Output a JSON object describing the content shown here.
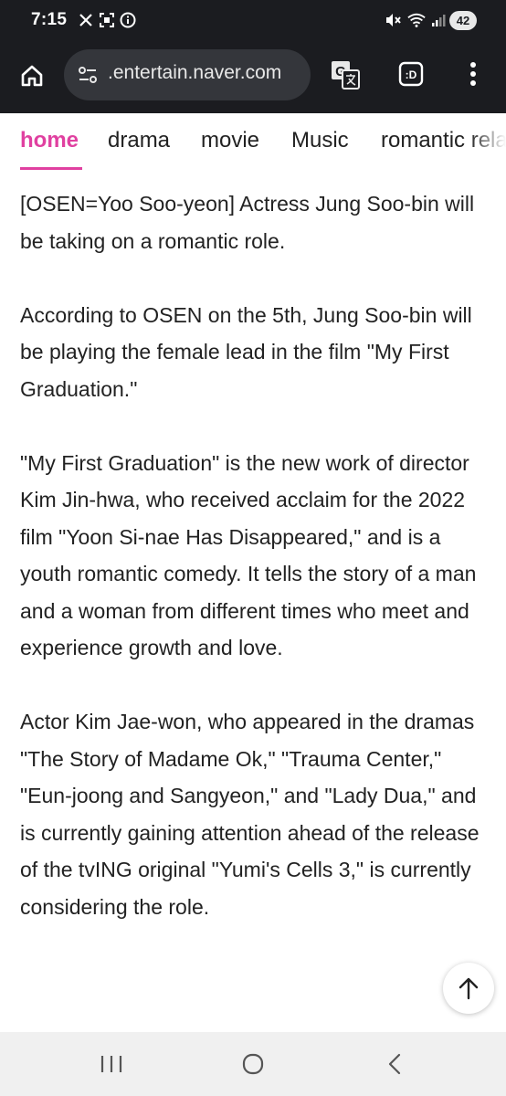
{
  "status_bar": {
    "time": "7:15",
    "battery_level": "42",
    "left_icons": [
      "x-logo-icon",
      "screenshot-icon",
      "info-icon"
    ],
    "right_icons": [
      "mute-icon",
      "wifi-icon",
      "signal-icon"
    ]
  },
  "browser": {
    "url": ".entertain.naver.com",
    "buttons": [
      "home-icon",
      "site-settings-icon",
      "translate-icon",
      "tabs-icon",
      "menu-icon"
    ]
  },
  "tabs": [
    {
      "label": "home",
      "active": true
    },
    {
      "label": "drama",
      "active": false
    },
    {
      "label": "movie",
      "active": false
    },
    {
      "label": "Music",
      "active": false
    },
    {
      "label": "romantic rela",
      "active": false
    }
  ],
  "article": {
    "paragraphs": [
      "[OSEN=Yoo Soo-yeon] Actress Jung Soo-bin will be taking on a romantic role.",
      "According to OSEN on the 5th, Jung Soo-bin will be playing the female lead in the film \"My First Graduation.\"",
      "\"My First Graduation\" is the new work of director Kim Jin-hwa, who received acclaim for the 2022 film \"Yoon Si-nae Has Disappeared,\" and is a youth romantic comedy. It tells the story of a man and a woman from different times who meet and experience growth and love.",
      "Actor Kim Jae-won, who appeared in the dramas \"The Story of Madame Ok,\" \"Trauma Center,\" \"Eun-joong and Sangyeon,\" and \"Lady Dua,\" and is currently gaining attention ahead of the release of the tvING original \"Yumi's Cells 3,\" is currently considering the role."
    ]
  },
  "scroll_top_button": "arrow-up-icon",
  "navbar": [
    "recent-apps-icon",
    "home-circle-icon",
    "back-icon"
  ],
  "colors": {
    "accent": "#e040a0",
    "toolbar_bg": "#1b1c20",
    "omnibox_bg": "#34363b",
    "text": "#222222"
  }
}
